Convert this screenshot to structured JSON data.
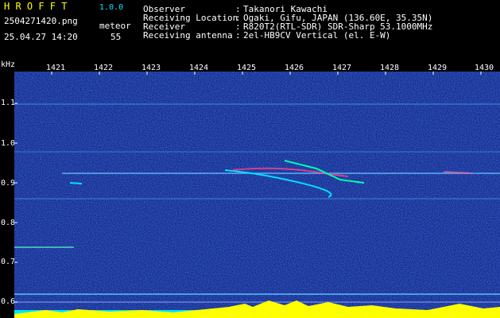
{
  "app": {
    "title_letters": "H R O F F T",
    "version": "1.0.0",
    "filename": "2504271420.png",
    "datetime": "25.04.27 14:20",
    "class_label": "meteor",
    "class_count": "55"
  },
  "info": {
    "observer_label": "Observer",
    "observer_value": "Takanori Kawachi",
    "location_label": "Receiving Location",
    "location_value": "Ogaki, Gifu, JAPAN (136.60E, 35.35N)",
    "receiver_label": "Receiver",
    "receiver_value": "R820T2(RTL-SDR) SDR-Sharp 53.1000MHz",
    "antenna_label": "Receiving antenna",
    "antenna_value": "2el-HB9CV Vertical (el. E-W)"
  },
  "axes": {
    "unit": "kHz",
    "x_ticks": [
      "1421",
      "1422",
      "1423",
      "1424",
      "1425",
      "1426",
      "1427",
      "1428",
      "1429",
      "1430"
    ],
    "y_ticks": [
      "1.1",
      "1.0",
      "0.9",
      "0.8",
      "0.7",
      "0.6"
    ]
  },
  "colors": {
    "background": "#000000",
    "waterfall_base": "#0b1a8a",
    "signal": "#00ff88",
    "header_yellow": "#ffff00",
    "header_white": "#ffffff"
  }
}
